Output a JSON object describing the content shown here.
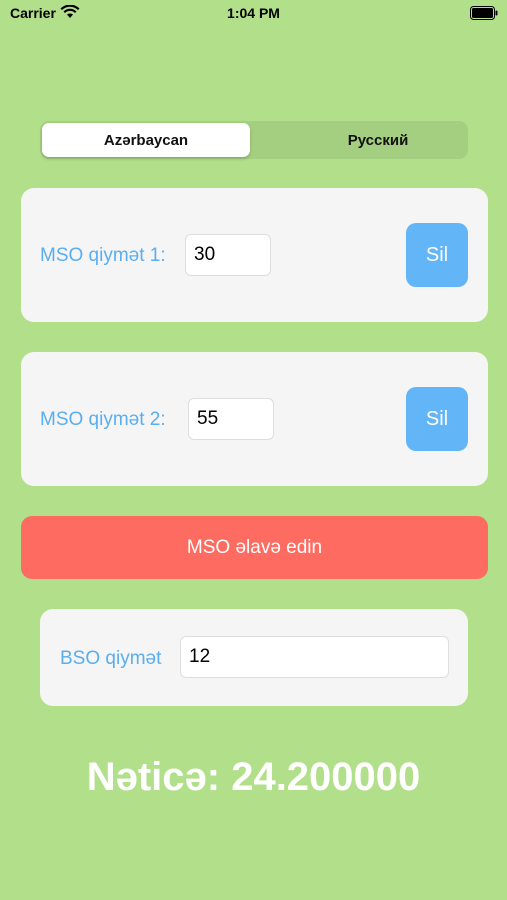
{
  "status_bar": {
    "carrier": "Carrier",
    "time": "1:04 PM"
  },
  "language_selector": {
    "options": [
      {
        "label": "Azərbaycan",
        "selected": true
      },
      {
        "label": "Русский",
        "selected": false
      }
    ]
  },
  "mso_entries": [
    {
      "label": "MSO qiymət 1:",
      "value": "30",
      "delete_label": "Sil"
    },
    {
      "label": "MSO qiymət 2:",
      "value": "55",
      "delete_label": "Sil"
    }
  ],
  "add_button": {
    "label": "MSO əlavə edin"
  },
  "bso": {
    "label": "BSO qiymət",
    "value": "12"
  },
  "result": {
    "text": "Nəticə: 24.200000"
  },
  "colors": {
    "background": "#b2df8a",
    "accent_blue": "#62b5f6",
    "label_blue": "#5aaef0",
    "add_red": "#fe6b61",
    "card": "#f5f5f5"
  }
}
